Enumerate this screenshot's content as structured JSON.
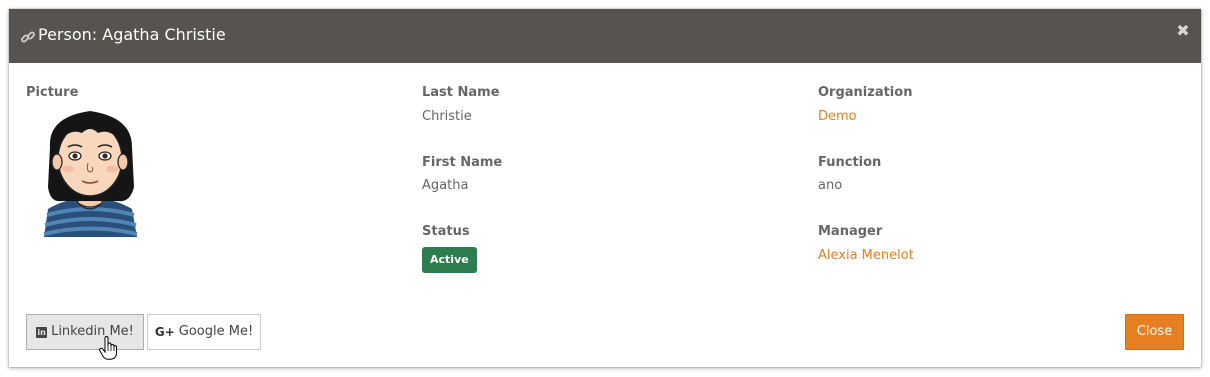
{
  "header": {
    "title": "Person: Agatha Christie",
    "link_icon": "link-icon",
    "close_icon": "close-icon",
    "close_glyph": "✖"
  },
  "picture": {
    "label": "Picture"
  },
  "fields": {
    "last_name_label": "Last Name",
    "last_name_value": "Christie",
    "first_name_label": "First Name",
    "first_name_value": "Agatha",
    "status_label": "Status",
    "status_value": "Active",
    "organization_label": "Organization",
    "organization_value": "Demo",
    "function_label": "Function",
    "function_value": "ano",
    "manager_label": "Manager",
    "manager_value": "Alexia Menelot"
  },
  "footer": {
    "linkedin_label": "Linkedin Me!",
    "linkedin_icon": "linkedin-icon",
    "google_label": "Google Me!",
    "google_icon": "google-plus-icon",
    "close_label": "Close"
  },
  "colors": {
    "header_bg": "#57544f",
    "accent": "#e67e22",
    "status_active": "#2e7d4f"
  }
}
